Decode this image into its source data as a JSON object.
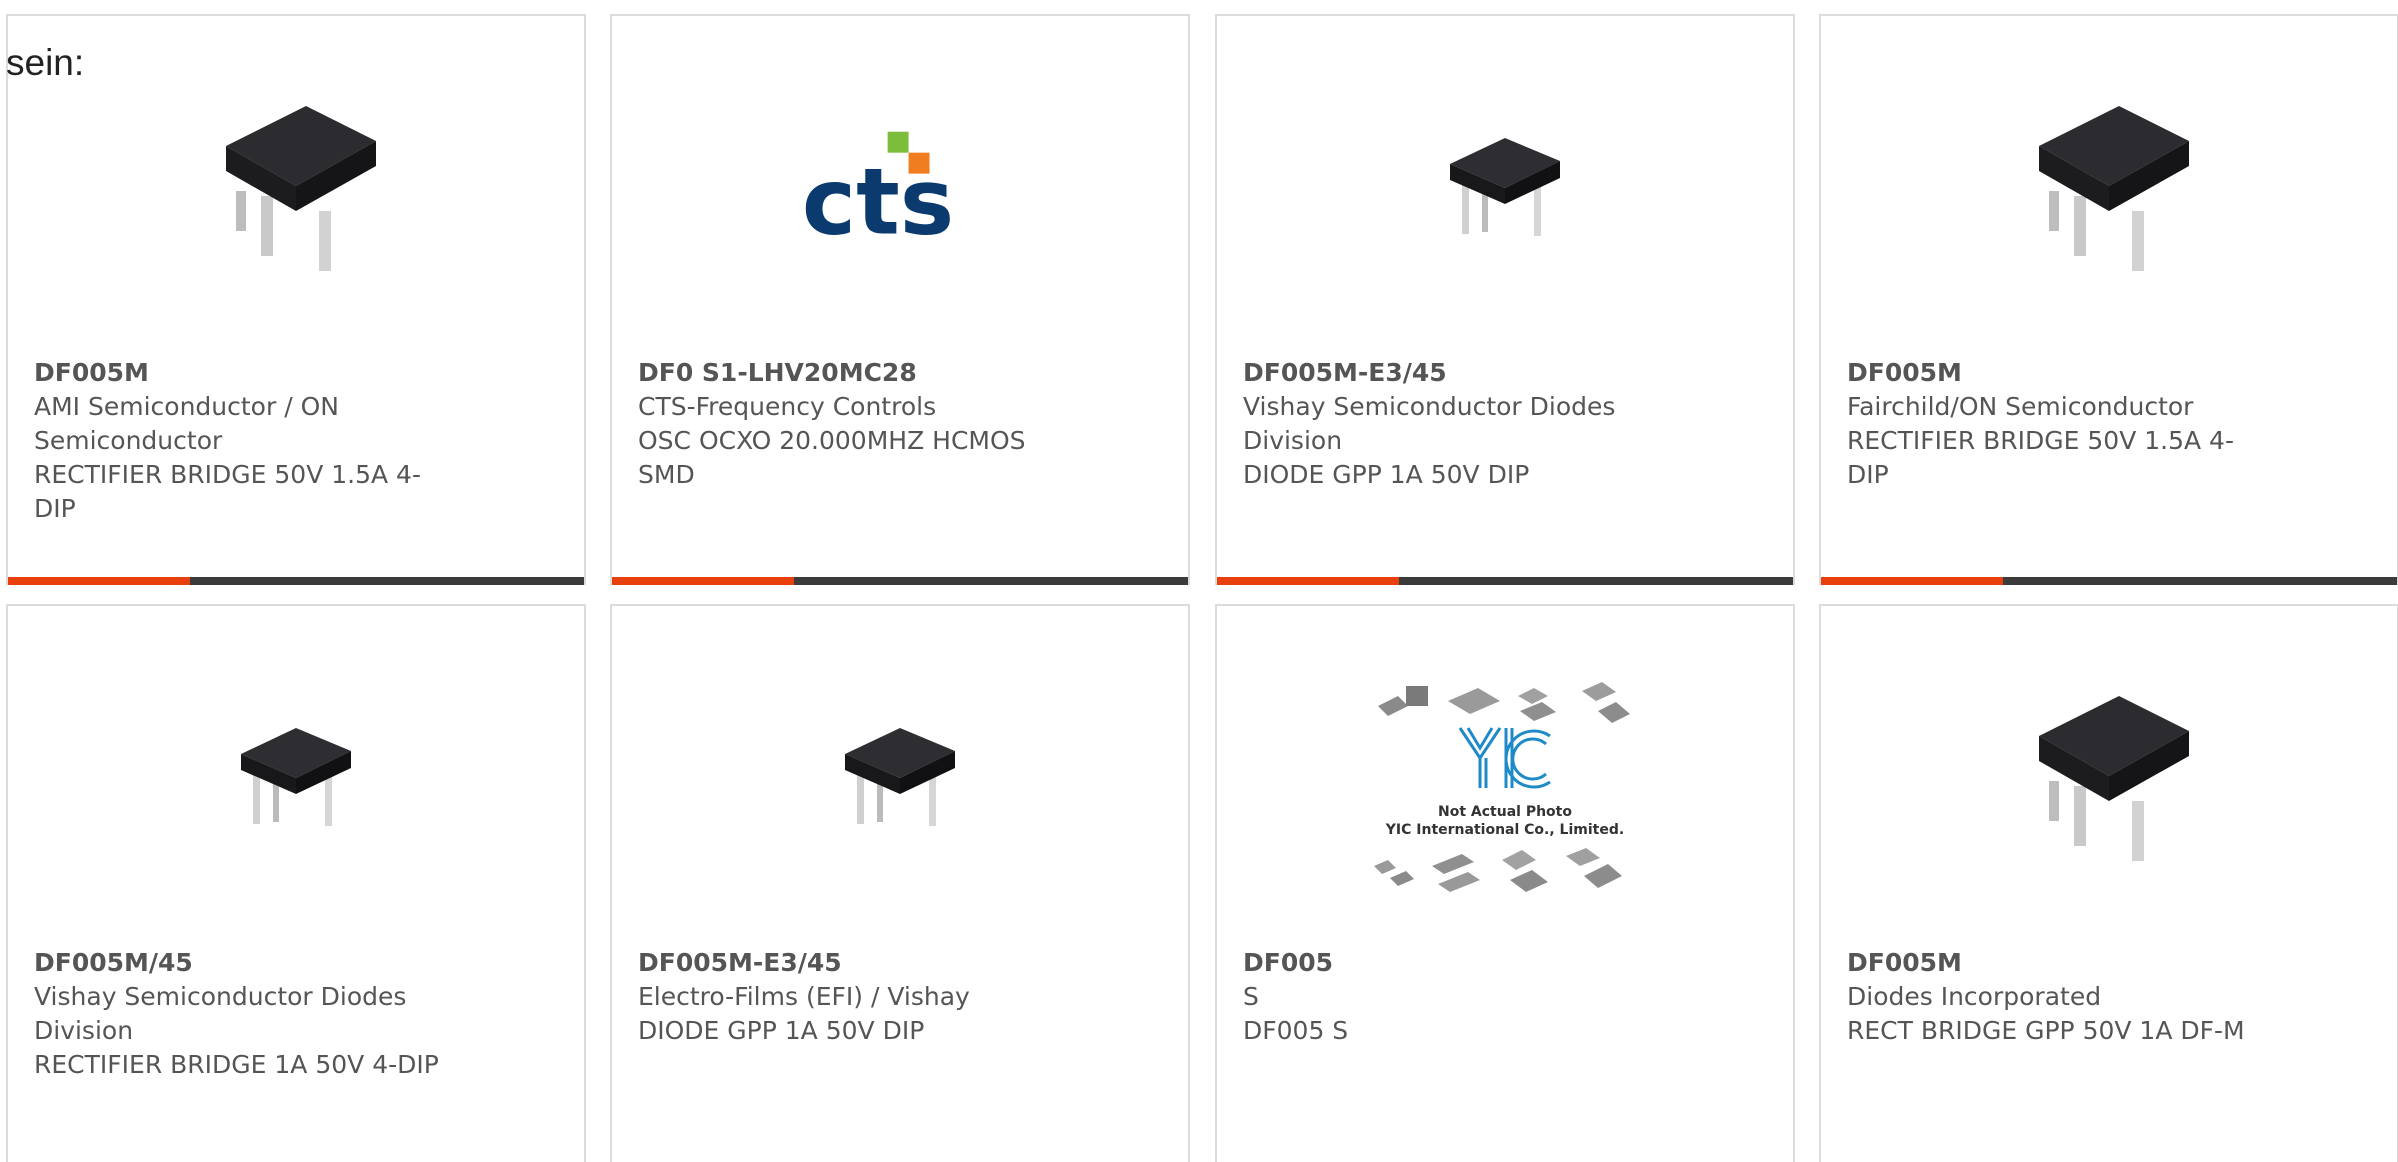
{
  "intro_text": "sein:",
  "products": [
    {
      "part": "DF005M",
      "manufacturer": "AMI Semiconductor / ON Semiconductor",
      "description": "RECTIFIER BRIDGE 50V 1.5A 4-DIP",
      "image": "dip-bridge-rectifier-large"
    },
    {
      "part": "DF0 S1-LHV20MC28",
      "manufacturer": "CTS-Frequency Controls",
      "description": "OSC OCXO 20.000MHZ HCMOS SMD",
      "image": "cts-logo"
    },
    {
      "part": "DF005M-E3/45",
      "manufacturer": "Vishay Semiconductor Diodes Division",
      "description": "DIODE GPP 1A 50V DIP",
      "image": "dip-bridge-rectifier-small"
    },
    {
      "part": "DF005M",
      "manufacturer": "Fairchild/ON Semiconductor",
      "description": "RECTIFIER BRIDGE 50V 1.5A 4-DIP",
      "image": "dip-bridge-rectifier-large"
    },
    {
      "part": "DF005M/45",
      "manufacturer": "Vishay Semiconductor Diodes Division",
      "description": "RECTIFIER BRIDGE 1A 50V 4-DIP",
      "image": "dip-bridge-rectifier-small"
    },
    {
      "part": "DF005M-E3/45",
      "manufacturer": "Electro-Films (EFI) / Vishay",
      "description": "DIODE GPP 1A 50V DIP",
      "image": "dip-bridge-rectifier-small"
    },
    {
      "part": "DF005",
      "manufacturer": "S",
      "description": "DF005 S",
      "image": "yic-not-actual-photo",
      "placeholder_line1": "Not Actual Photo",
      "placeholder_line2": "YIC International Co., Limited."
    },
    {
      "part": "DF005M",
      "manufacturer": "Diodes Incorporated",
      "description": "RECT BRIDGE GPP 50V 1A DF-M",
      "image": "dip-bridge-rectifier-large"
    }
  ],
  "colors": {
    "accent": "#e8400c",
    "bar": "#3b3b3b",
    "text": "#555555",
    "cts_blue": "#0b3a6e",
    "cts_green": "#7cbd3b",
    "cts_orange": "#f07d1f",
    "yic_blue": "#1f8ac8"
  }
}
